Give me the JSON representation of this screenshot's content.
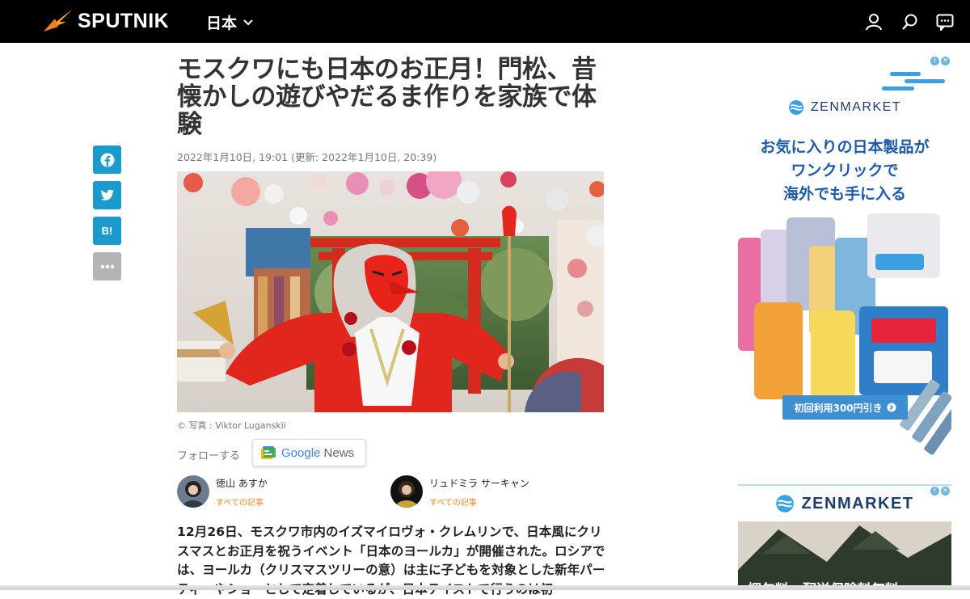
{
  "header": {
    "logo_text": "SPUTNIK",
    "region": "日本",
    "icons": [
      "user-icon",
      "search-icon",
      "chat-icon"
    ]
  },
  "share": {
    "icons": [
      "facebook-icon",
      "twitter-icon",
      "hatena-bookmark-icon",
      "more-icon"
    ],
    "hatena_label": "B!",
    "colors": {
      "social": "#1a9bcb",
      "more": "#b4b4b4"
    }
  },
  "article": {
    "title": "モスクワにも日本のお正月！門松、昔懐かしの遊びやだるま作りを家族で体験",
    "date": "2022年1月10日, 19:01 (更新: 2022年1月10日, 20:39)",
    "photo_credit": "© 写真 : Viktor Luganskii",
    "follow_label": "フォローする",
    "google_news_label_1": "Google",
    "google_news_label_2": "News",
    "authors": [
      {
        "name": "徳山 あすか",
        "link": "すべての記事"
      },
      {
        "name": "リュドミラ サーキャン",
        "link": "すべての記事"
      }
    ],
    "lead": "12月26日、モスクワ市内のイズマイロヴォ・クレムリンで、日本風にクリスマスとお正月を祝うイベント「日本のヨールカ」が開催された。ロシアでは、ヨールカ（クリスマスツリーの意）は主に子どもを対象とした新年パーティーやショーとして定着しているが、日本テイストで行うのは初"
  },
  "ads": {
    "brand": "ZENMARKET",
    "headline_1": "お気に入りの日本製品が",
    "headline_2": "ワンクリックで",
    "headline_3": "海外でも手に入る",
    "cta": "初回利用300円引き",
    "bottom_promo": "梱包料・配送保険料無料",
    "colors": {
      "brand": "#1e3c6a",
      "headline": "#1f5aa6",
      "cta": "#3d8fd1"
    }
  }
}
